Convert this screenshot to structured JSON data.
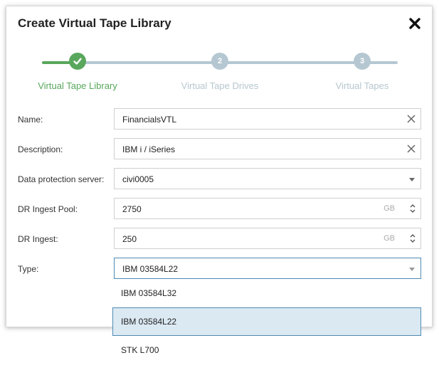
{
  "dialog": {
    "title": "Create Virtual Tape Library"
  },
  "steps": [
    {
      "label": "Virtual Tape Library",
      "number": "",
      "state": "done"
    },
    {
      "label": "Virtual Tape Drives",
      "number": "2",
      "state": "pending"
    },
    {
      "label": "Virtual Tapes",
      "number": "3",
      "state": "pending"
    }
  ],
  "form": {
    "name": {
      "label": "Name:",
      "value": "FinancialsVTL"
    },
    "description": {
      "label": "Description:",
      "value": "IBM i / iSeries"
    },
    "server": {
      "label": "Data protection server:",
      "value": "civi0005"
    },
    "pool": {
      "label": "DR Ingest Pool:",
      "value": "2750",
      "unit": "GB"
    },
    "ingest": {
      "label": "DR Ingest:",
      "value": "250",
      "unit": "GB"
    },
    "type": {
      "label": "Type:",
      "value": "IBM 03584L22"
    }
  },
  "type_options": [
    "IBM 03584L32",
    "IBM 03584L22",
    "STK L700"
  ],
  "icons": {
    "close": "close-icon",
    "clear": "clear-icon",
    "check": "checkmark-icon",
    "caret": "chevron-down-icon",
    "spinner": "spinner-icon"
  },
  "colors": {
    "success": "#59a75c",
    "pending": "#b5c8d2",
    "selected": "#dbe9f3",
    "focus": "#4f8bb4"
  }
}
